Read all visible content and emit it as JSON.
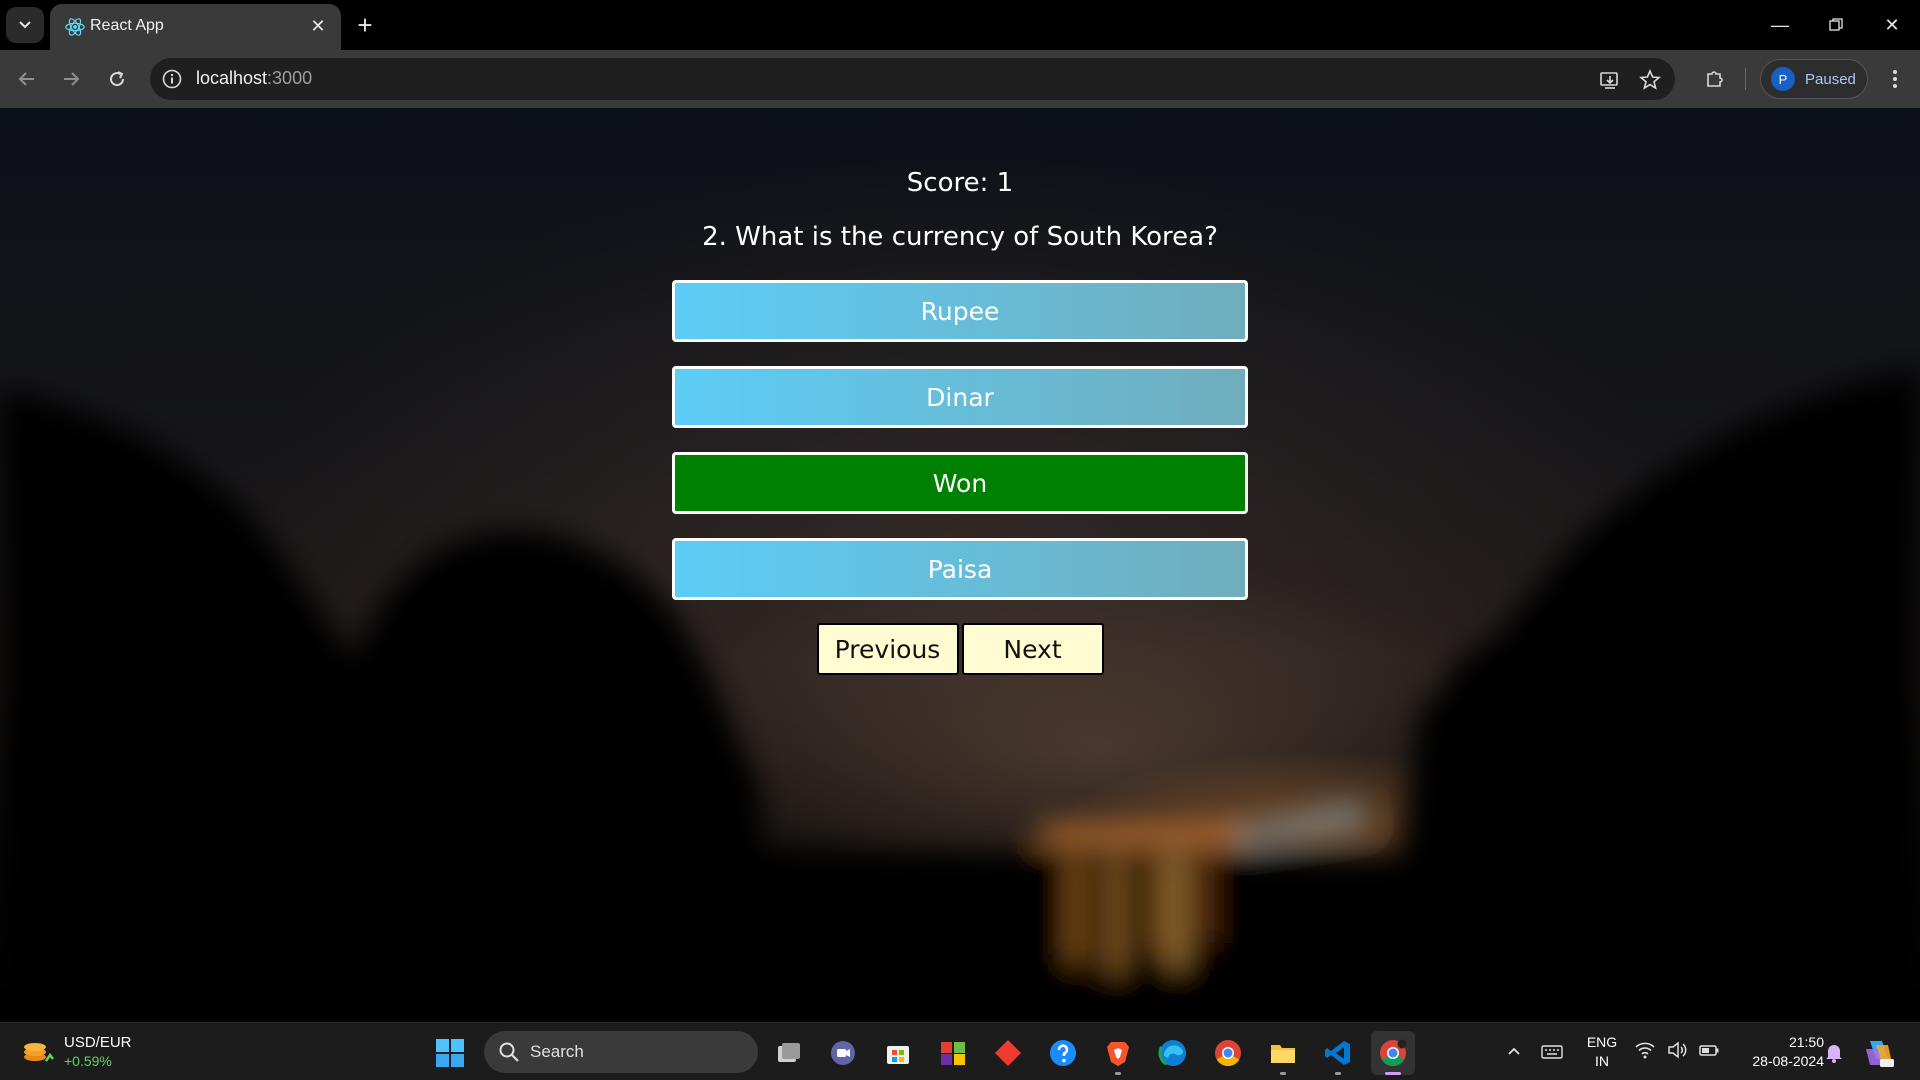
{
  "browser": {
    "tab_title": "React App",
    "url_host": "localhost",
    "url_port": ":3000",
    "profile_initial": "P",
    "profile_status": "Paused"
  },
  "quiz": {
    "score_text": "Score: 1",
    "question_text": "2. What is the currency of South Korea?",
    "options": [
      {
        "label": "Rupee",
        "state": "default"
      },
      {
        "label": "Dinar",
        "state": "default"
      },
      {
        "label": "Won",
        "state": "correct"
      },
      {
        "label": "Paisa",
        "state": "default"
      }
    ],
    "previous_label": "Previous",
    "next_label": "Next",
    "colors": {
      "option_gradient_start": "#5ccdf7",
      "option_gradient_end": "#70adbc",
      "correct": "#008000",
      "nav_button_bg": "#fffcd2"
    }
  },
  "taskbar": {
    "widget_title": "USD/EUR",
    "widget_change": "+0.59%",
    "search_label": "Search",
    "lang_top": "ENG",
    "lang_bottom": "IN",
    "time": "21:50",
    "date": "28-08-2024",
    "apps": [
      "task-view",
      "teams-meet",
      "microsoft-store",
      "office",
      "git-app",
      "help",
      "brave",
      "edge",
      "chrome",
      "file-explorer",
      "vscode",
      "chrome-profile"
    ]
  }
}
